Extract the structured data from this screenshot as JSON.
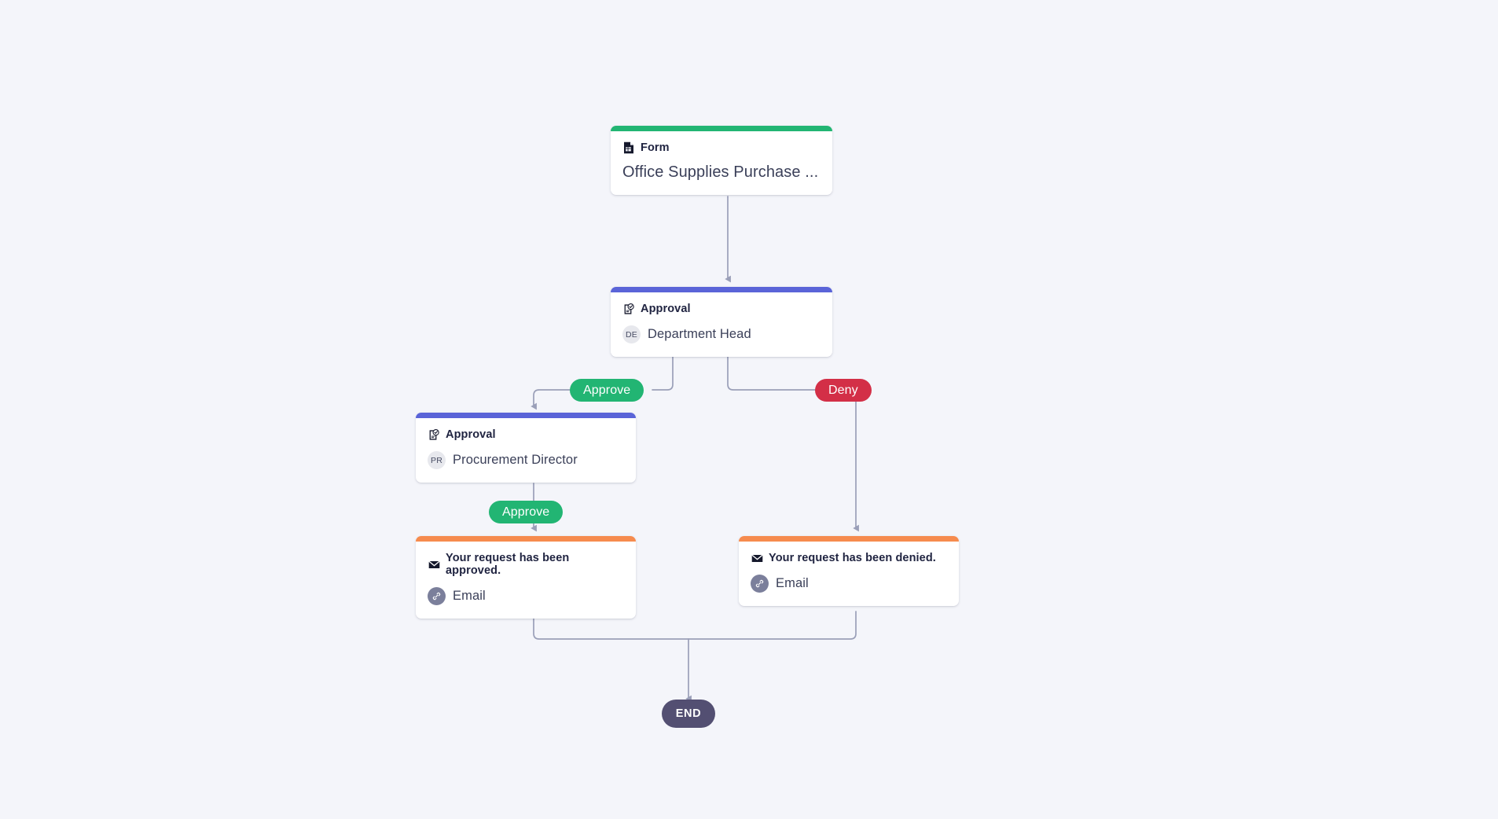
{
  "canvas": {
    "background_color": "#f4f5fa",
    "edge_color": "#9a9fb8"
  },
  "palette": {
    "form_accent": "#22b573",
    "approval_accent": "#5a64d8",
    "email_accent": "#f68b4e",
    "approve_pill": "#22b573",
    "deny_pill": "#d32f47",
    "end_node": "#534f72",
    "avatar_bg": "#e7e8ed",
    "link_badge_bg": "#7b7f9b"
  },
  "nodes": {
    "form": {
      "type_label": "Form",
      "icon": "document-icon",
      "title": "Office Supplies Purchase ..."
    },
    "approval_department_head": {
      "type_label": "Approval",
      "icon": "clipboard-check-icon",
      "avatar_initials": "DE",
      "assignee": "Department Head"
    },
    "approval_procurement_director": {
      "type_label": "Approval",
      "icon": "clipboard-check-icon",
      "avatar_initials": "PR",
      "assignee": "Procurement Director"
    },
    "email_approved": {
      "icon": "envelope-icon",
      "subject": "Your request has been approved.",
      "channel_icon": "link-icon",
      "channel": "Email"
    },
    "email_denied": {
      "icon": "envelope-icon",
      "subject": "Your request has been denied.",
      "channel_icon": "link-icon",
      "channel": "Email"
    },
    "end": {
      "label": "END"
    }
  },
  "branches": {
    "approve_first": "Approve",
    "deny_first": "Deny",
    "approve_second": "Approve"
  }
}
